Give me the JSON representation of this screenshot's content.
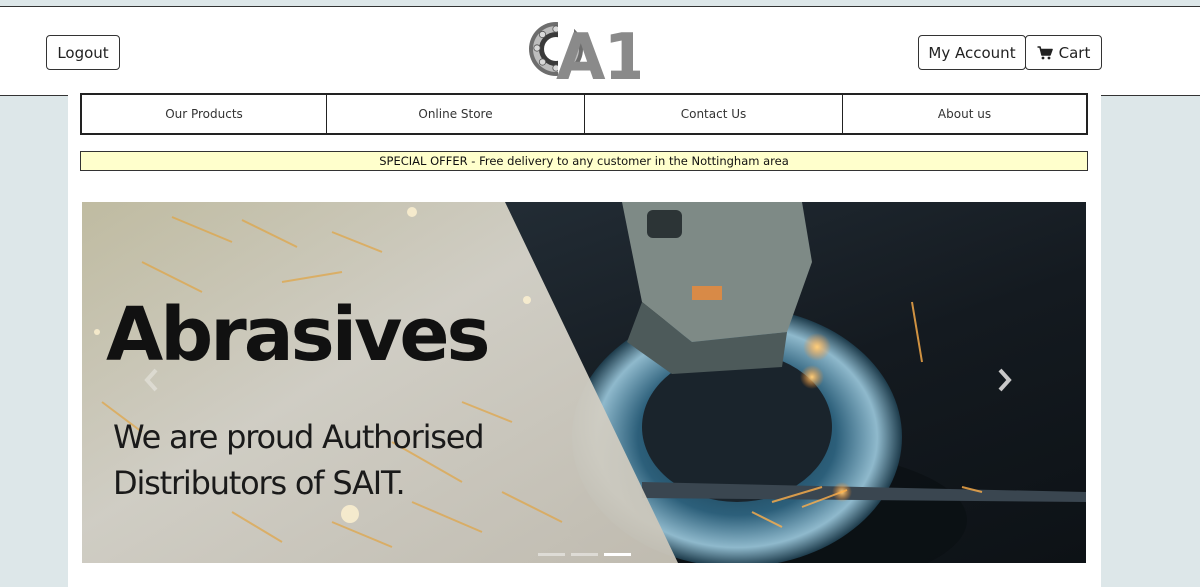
{
  "header": {
    "logout_label": "Logout",
    "logo_text": "A1",
    "my_account_label": "My Account",
    "cart_label": "Cart",
    "cart_icon": "shopping-cart-icon"
  },
  "nav": {
    "items": [
      {
        "label": "Our Products"
      },
      {
        "label": "Online Store"
      },
      {
        "label": "Contact Us"
      },
      {
        "label": "About us"
      }
    ]
  },
  "offer": {
    "text": "SPECIAL OFFER - Free delivery to any customer in the Nottingham area"
  },
  "carousel": {
    "headline": "Abrasives",
    "subline": "We are proud Authorised Distributors of SAIT.",
    "prev_icon": "chevron-left-icon",
    "next_icon": "chevron-right-icon",
    "slide_count": 3,
    "active_slide": 3
  },
  "colors": {
    "page_background": "#dde7e9",
    "offer_background": "#ffffcc",
    "border": "#222222"
  }
}
